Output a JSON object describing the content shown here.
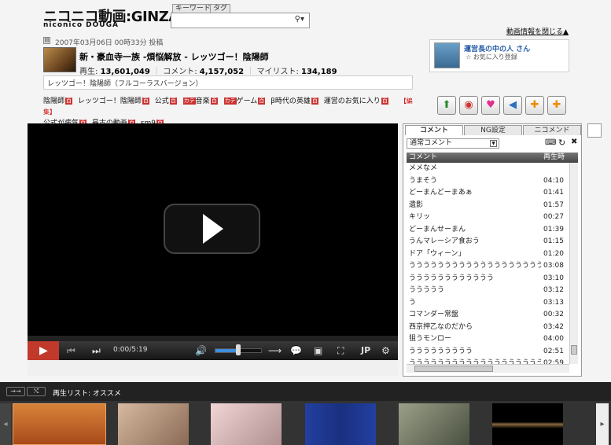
{
  "header": {
    "logo": "ニコニコ動画:GINZA",
    "logo_sub": "niconico DOUGA",
    "search_tabs": [
      "キーワード",
      "タグ"
    ],
    "close_info": "動画情報を閉じる▲"
  },
  "owner": {
    "name": "運営長の中の人 さん",
    "fav": "☆ お気に入り登録"
  },
  "video": {
    "post_date": "2007年03月06日 00時33分 投稿",
    "title": "新・豪血寺一族 -煩悩解放 - レッツゴー！陰陽師",
    "views_label": "再生:",
    "views": "13,601,049",
    "comments_label": "コメント:",
    "comments": "4,157,052",
    "mylist_label": "マイリスト:",
    "mylist": "134,189",
    "description": "レッツゴー！陰陽師（フルコーラスバージョン）"
  },
  "tags": [
    "陰陽師",
    "レッツゴー！陰陽師",
    "公式",
    "音楽",
    "ゲーム",
    "β時代の英雄",
    "運営のお気に入り",
    "公式が病気",
    "最古の動画",
    "sm9"
  ],
  "tags_edit": "【編集】",
  "player": {
    "time": "0:00/5:19",
    "lang": "JP",
    "volume": 0.5
  },
  "comment_panel": {
    "tabs": [
      "コメント",
      "NG設定",
      "ニコメンド"
    ],
    "select": "通常コメント",
    "col_comment": "コメント",
    "col_time": "再生時",
    "rows": [
      {
        "c": "メメなメ",
        "t": ""
      },
      {
        "c": "うまそう",
        "t": "04:10"
      },
      {
        "c": "どーまんどーまあぁ",
        "t": "01:41"
      },
      {
        "c": "遺影",
        "t": "01:57"
      },
      {
        "c": "キリッ",
        "t": "00:27"
      },
      {
        "c": "どーまんせーまん",
        "t": "01:39"
      },
      {
        "c": "うんマレーシア食おう",
        "t": "01:15"
      },
      {
        "c": "ドア「ウィーン」",
        "t": "01:20"
      },
      {
        "c": "うううううううううううううううううううう",
        "t": "03:08"
      },
      {
        "c": "うううううううううううう",
        "t": "03:10"
      },
      {
        "c": "ううううう",
        "t": "03:12"
      },
      {
        "c": "う",
        "t": "03:13"
      },
      {
        "c": "コマンダー常盤",
        "t": "00:32"
      },
      {
        "c": "西京押乙なのだから",
        "t": "03:42"
      },
      {
        "c": "狙うモンロー",
        "t": "04:00"
      },
      {
        "c": "ううううううううう",
        "t": "02:51"
      },
      {
        "c": "ううううううううううううううううううう",
        "t": "02:59"
      }
    ]
  },
  "playlist": {
    "label": "再生リスト: オススメ"
  }
}
